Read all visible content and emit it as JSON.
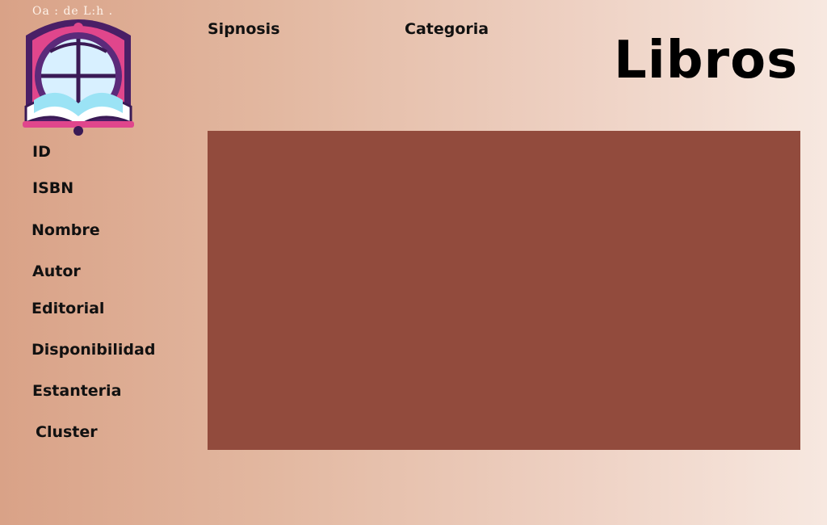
{
  "logo": {
    "text": "Oa : de L:h ."
  },
  "header": {
    "title": "Libros",
    "tabs": [
      {
        "label": "Sipnosis"
      },
      {
        "label": "Categoria"
      }
    ]
  },
  "sidebar": {
    "fields": [
      {
        "label": "ID"
      },
      {
        "label": "ISBN"
      },
      {
        "label": "Nombre"
      },
      {
        "label": "Autor"
      },
      {
        "label": "Editorial"
      },
      {
        "label": "Disponibilidad"
      },
      {
        "label": "Estanteria"
      },
      {
        "label": "Cluster"
      }
    ]
  },
  "colors": {
    "panel": "#924b3d",
    "logo_purple": "#5b2a7a",
    "logo_pink": "#e24b8f"
  }
}
